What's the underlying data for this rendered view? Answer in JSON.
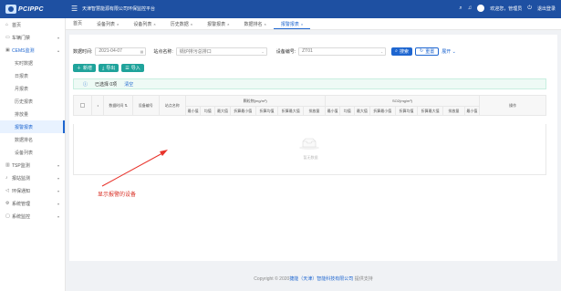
{
  "header": {
    "logo_text": "PCIPPC",
    "system_title": "天津智慧能源有限公司环保监控平台",
    "welcome": "欢迎您，管理员",
    "logout": "退出登录",
    "colors": {
      "brand": "#1e50a2",
      "accent": "#1e66d0",
      "teal": "#1fa39b"
    }
  },
  "sidebar": {
    "items": [
      {
        "icon": "home-icon",
        "label": "首页",
        "arrow": ""
      },
      {
        "icon": "car-icon",
        "label": "车辆门禁",
        "arrow": "▾"
      },
      {
        "icon": "monitor-icon",
        "label": "CEMS监测",
        "arrow": "▴",
        "open": true,
        "children": [
          "实时数据",
          "日报表",
          "月报表",
          "历史报表",
          "排放量",
          "报警报表",
          "数据排名",
          "设备列表"
        ]
      },
      {
        "icon": "chart-icon",
        "label": "TSP监测",
        "arrow": "▾"
      },
      {
        "icon": "bell-icon",
        "label": "报站监测",
        "arrow": "▾"
      },
      {
        "icon": "warning-icon",
        "label": "环保通知",
        "arrow": "▾"
      },
      {
        "icon": "gear-icon",
        "label": "系统管理",
        "arrow": "▾"
      },
      {
        "icon": "computer-icon",
        "label": "系统监控",
        "arrow": "▾"
      }
    ],
    "active_child": "报警报表"
  },
  "tabs": [
    {
      "label": "首页",
      "closable": false
    },
    {
      "label": "设备列表",
      "closable": true
    },
    {
      "label": "设备列表",
      "closable": true
    },
    {
      "label": "历史数据",
      "closable": true
    },
    {
      "label": "报警报表",
      "closable": true
    },
    {
      "label": "数据排名",
      "closable": true
    },
    {
      "label": "报警报表",
      "closable": true,
      "active": true
    }
  ],
  "filter": {
    "date_label": "数据时间:",
    "date_value": "2021-04-07",
    "station_label": "站点名称:",
    "station_value": "锅炉排污总排口",
    "device_label": "设备编号:",
    "device_value": "ZT01",
    "search": "搜索",
    "reset": "重置",
    "expand": "展开"
  },
  "toolbar": {
    "add": "新增",
    "export": "导出",
    "import": "导入"
  },
  "selection": {
    "text": "已选择 0项",
    "clear": "清空"
  },
  "table": {
    "headers": [
      "",
      "",
      "数据时间",
      "设备编号",
      "站点名称"
    ],
    "group1": "颗粒物(mg/m³)",
    "group2": "SO2(mg/m³)",
    "action": "操作",
    "subheaders": [
      "最小值",
      "均值",
      "最大值",
      "折算最小值",
      "折算均值",
      "折算最大值",
      "排放量",
      "最小值",
      "均值",
      "最大值",
      "折算最小值",
      "折算均值",
      "折算最大值",
      "排放量",
      "最小值"
    ],
    "empty": "暂无数据"
  },
  "annotation": "显示报警的设备",
  "footer": {
    "prefix": "Copyright ",
    "year": "2020",
    "company": "捷能（天津）智能科技有限公司",
    "suffix": " 提供支持"
  }
}
